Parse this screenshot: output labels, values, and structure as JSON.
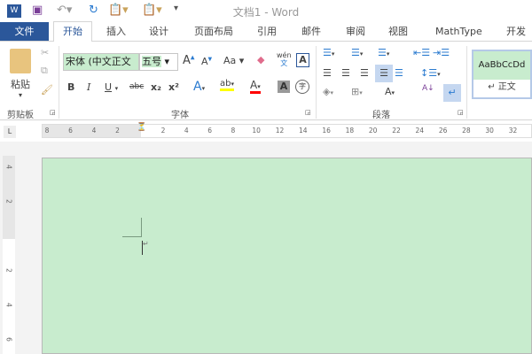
{
  "window": {
    "title": "文档1 - Word"
  },
  "quick_access": {
    "icons": [
      "word-logo-icon",
      "save-icon",
      "undo-icon",
      "redo-icon",
      "paste-icon",
      "paste-special-icon",
      "customize-icon"
    ]
  },
  "tabs": [
    {
      "label": "文件"
    },
    {
      "label": "开始"
    },
    {
      "label": "插入"
    },
    {
      "label": "设计"
    },
    {
      "label": "页面布局"
    },
    {
      "label": "引用"
    },
    {
      "label": "邮件"
    },
    {
      "label": "审阅"
    },
    {
      "label": "视图"
    },
    {
      "label": "MathType"
    },
    {
      "label": "开发工"
    }
  ],
  "ribbon": {
    "clipboard": {
      "label": "剪贴板",
      "paste": "粘贴"
    },
    "font": {
      "label": "字体",
      "font_name": "宋体 (中文正文",
      "font_size": "五号",
      "change_case": "Aa",
      "bold": "B",
      "italic": "I",
      "underline": "U",
      "strike": "abc",
      "sub": "x₂",
      "sup": "x²",
      "phonetic_top": "wén",
      "phonetic_bottom": "文",
      "border_char": "A",
      "circle_char": "字"
    },
    "paragraph": {
      "label": "段落"
    },
    "styles": {
      "preview": "AaBbCcDd",
      "name": "正文"
    }
  },
  "ruler": {
    "corner": "L",
    "left_ticks": [
      "8",
      "6",
      "4",
      "2"
    ],
    "right_ticks": [
      "2",
      "4",
      "6",
      "8",
      "10",
      "12",
      "14",
      "16",
      "18",
      "20",
      "22",
      "24",
      "26",
      "28",
      "30",
      "32"
    ],
    "vertical_ticks": [
      "4",
      "2",
      "2",
      "4",
      "6"
    ]
  },
  "colors": {
    "accent": "#2b579a",
    "page_background": "#c8ecce",
    "highlight": "#ffff00",
    "font_color": "#ff0000"
  }
}
